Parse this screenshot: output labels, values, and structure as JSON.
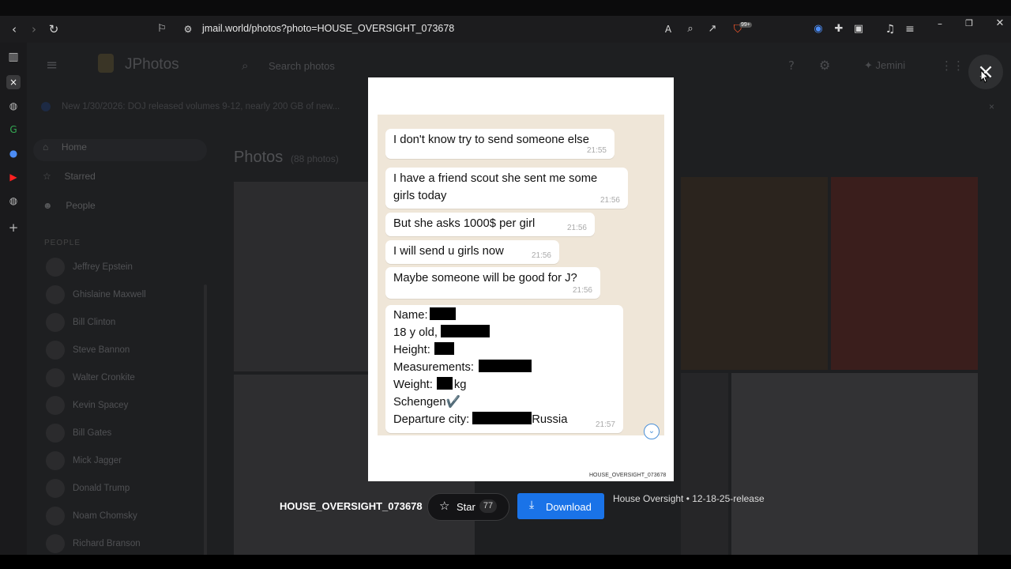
{
  "browser": {
    "url": "jmail.world/photos?photo=HOUSE_OVERSIGHT_073678",
    "extension_badge": "99+"
  },
  "app": {
    "logo_text": "JPhotos",
    "search_placeholder": "Search photos",
    "account_label": "Jemini",
    "notice": "New 1/30/2026: DOJ released volumes 9-12, nearly 200 GB of new...",
    "nav": [
      "Home",
      "Starred",
      "People"
    ],
    "people_header": "PEOPLE",
    "people": [
      "Jeffrey Epstein",
      "Ghislaine Maxwell",
      "Bill Clinton",
      "Steve Bannon",
      "Walter Cronkite",
      "Kevin Spacey",
      "Bill Gates",
      "Mick Jagger",
      "Donald Trump",
      "Noam Chomsky",
      "Richard Branson"
    ],
    "photos_title": "Photos",
    "photos_count": "(88 photos)"
  },
  "chat": {
    "messages": [
      {
        "text": "I don't know try to send someone else",
        "time": "21:55"
      },
      {
        "line1": "I have a friend scout she sent me some",
        "line2": "girls today",
        "time": "21:56"
      },
      {
        "text": "But she asks 1000$  per girl",
        "time": "21:56"
      },
      {
        "text": "I will send u girls now",
        "time": "21:56"
      },
      {
        "text": "Maybe someone will be good for J?",
        "time": "21:56"
      }
    ],
    "profile": {
      "name_label": "Name:",
      "age_label": "18 y old,",
      "height_label": "Height:",
      "measurements_label": "Measurements:",
      "weight_label": "Weight:",
      "weight_unit": "kg",
      "schengen": "Schengen✔️",
      "departure_label": "Departure city:",
      "departure_suffix": "Russia",
      "time": "21:57"
    },
    "doc_stamp": "HOUSE_OVERSIGHT_073678"
  },
  "viewer": {
    "photo_id": "HOUSE_OVERSIGHT_073678",
    "star_label": "Star",
    "star_count": "77",
    "download_label": "Download",
    "release_text": "House Oversight • 12-18-25-release",
    "close_icon": "×"
  }
}
